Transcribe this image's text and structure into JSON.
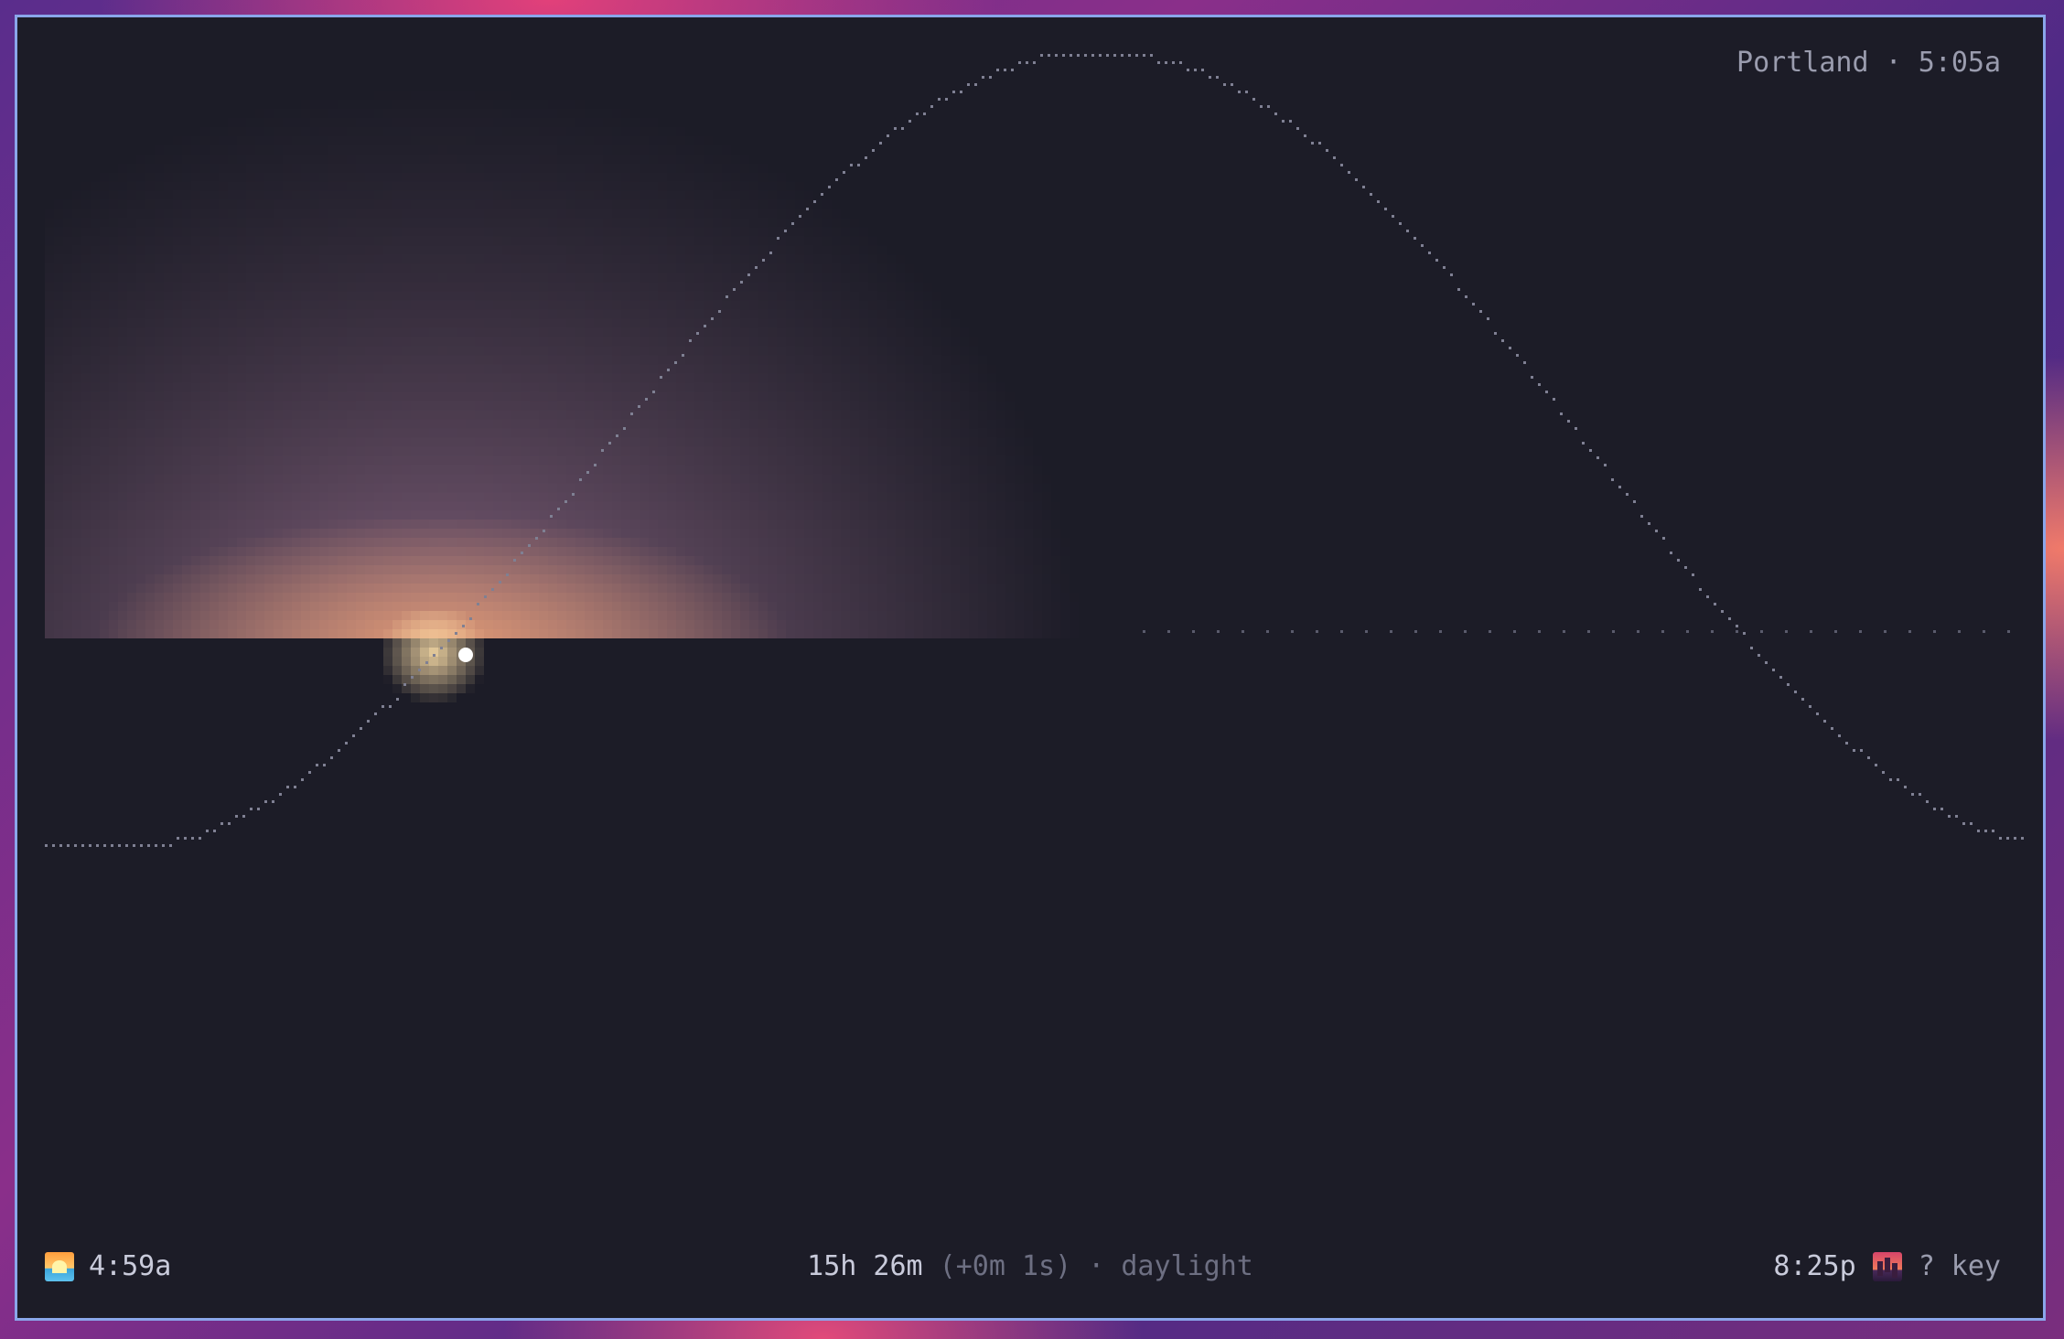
{
  "header": {
    "location_time": "Portland · 5:05a"
  },
  "footer": {
    "sunrise_time": "4:59a",
    "day_length": "15h 26m",
    "day_delta": " (+0m 1s) · daylight",
    "sunset_time": "8:25p",
    "key_hint": "? key"
  },
  "icons": {
    "sunrise": "sunrise-icon",
    "sunset": "sunset-icon"
  },
  "colors": {
    "frame_border": "#8aa6ea",
    "panel_bg": "#1c1c27",
    "dots": "#7f8093",
    "sun": "#ffffff",
    "glow": "#e8a070"
  }
}
